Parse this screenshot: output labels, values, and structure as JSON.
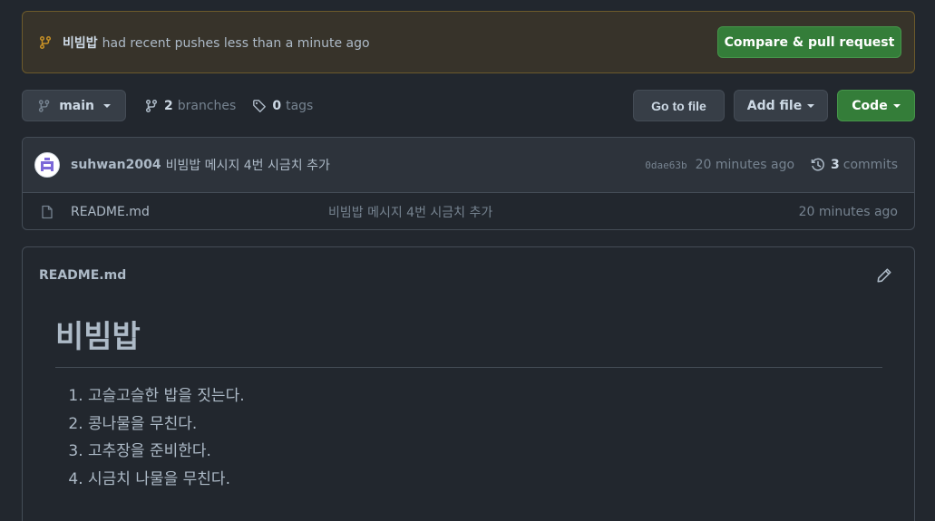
{
  "banner": {
    "branch_name": "비빔밥",
    "message": "had recent pushes less than a minute ago",
    "compare_button": "Compare & pull request"
  },
  "branch_bar": {
    "branch_label": "main",
    "branches_count": "2",
    "branches_label": "branches",
    "tags_count": "0",
    "tags_label": "tags",
    "go_to_file": "Go to file",
    "add_file": "Add file",
    "code": "Code"
  },
  "latest_commit": {
    "author": "suhwan2004",
    "message": "비빔밥 메시지 4번 시금치 추가",
    "sha": "0dae63b",
    "time": "20 minutes ago",
    "commits_count": "3",
    "commits_label": "commits"
  },
  "files": [
    {
      "name": "README.md",
      "commit_message": "비빔밥 메시지 4번 시금치 추가",
      "time": "20 minutes ago"
    }
  ],
  "readme": {
    "title": "README.md",
    "heading": "비빔밥",
    "items": [
      "고슬고슬한 밥을 짓는다.",
      "콩나물을 무친다.",
      "고추장을 준비한다.",
      "시금치 나물을 무친다."
    ]
  },
  "colors": {
    "background": "#22272e",
    "banner_bg": "#37332a",
    "accent_green": "#347d39",
    "banner_icon": "#c69026"
  }
}
